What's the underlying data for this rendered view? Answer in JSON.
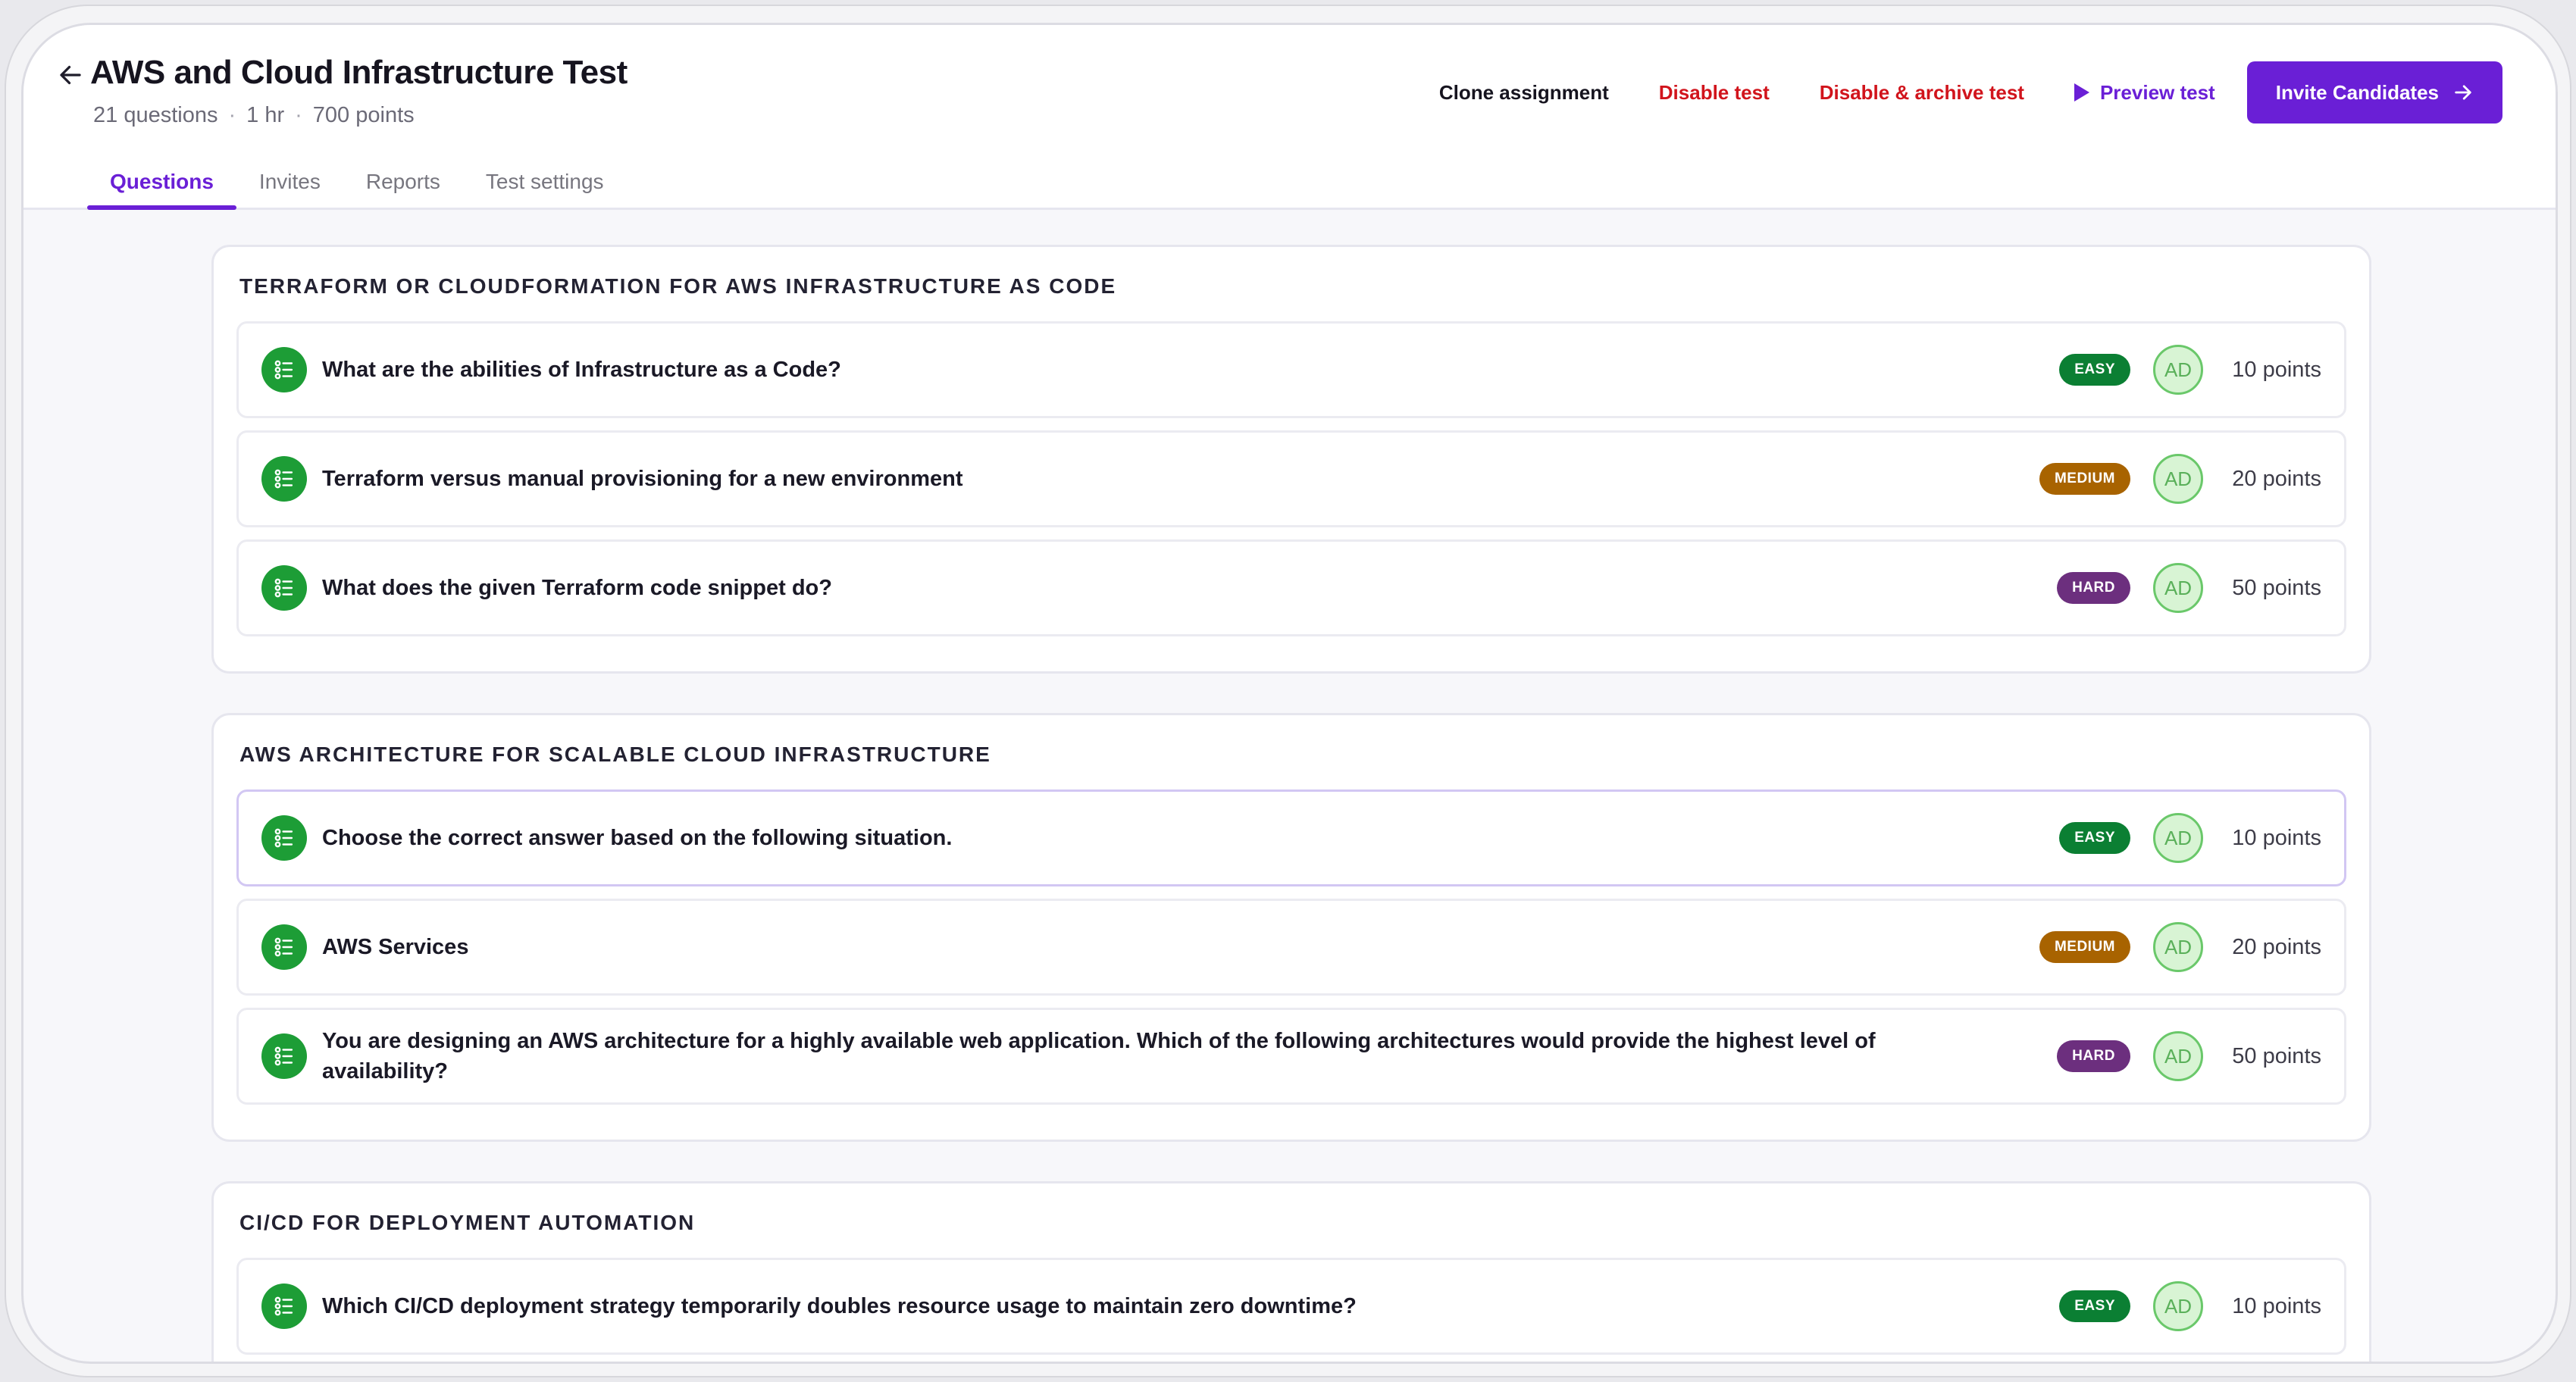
{
  "header": {
    "title": "AWS and Cloud Infrastructure Test",
    "meta": {
      "questions": "21 questions",
      "duration": "1 hr",
      "points": "700 points",
      "separator": "·"
    },
    "actions": {
      "clone": "Clone assignment",
      "disable": "Disable test",
      "disable_archive": "Disable & archive test",
      "preview": "Preview test",
      "invite": "Invite Candidates"
    },
    "tabs": [
      "Questions",
      "Invites",
      "Reports",
      "Test settings"
    ],
    "active_tab": "Questions"
  },
  "colors": {
    "accent": "#6a1fd6",
    "danger": "#d1141c",
    "easy": "#0b7f33",
    "medium": "#a86300",
    "hard": "#6c2f7e",
    "question_icon": "#1d9d36"
  },
  "sections": [
    {
      "title": "TERRAFORM OR CLOUDFORMATION FOR AWS INFRASTRUCTURE AS CODE",
      "questions": [
        {
          "text": "What are the abilities of Infrastructure as a Code?",
          "difficulty": "EASY",
          "author": "AD",
          "points": "10 points"
        },
        {
          "text": "Terraform versus manual provisioning for a new environment",
          "difficulty": "MEDIUM",
          "author": "AD",
          "points": "20 points"
        },
        {
          "text": "What does the given Terraform code snippet do?",
          "difficulty": "HARD",
          "author": "AD",
          "points": "50 points"
        }
      ]
    },
    {
      "title": "AWS ARCHITECTURE FOR SCALABLE CLOUD INFRASTRUCTURE",
      "questions": [
        {
          "text": "Choose the correct answer based on the following situation.",
          "difficulty": "EASY",
          "author": "AD",
          "points": "10 points"
        },
        {
          "text": "AWS Services",
          "difficulty": "MEDIUM",
          "author": "AD",
          "points": "20 points"
        },
        {
          "text": "You are designing an AWS architecture for a highly available web application. Which of the following architectures would provide the highest level of availability?",
          "difficulty": "HARD",
          "author": "AD",
          "points": "50 points"
        }
      ]
    },
    {
      "title": "CI/CD FOR DEPLOYMENT AUTOMATION",
      "questions": [
        {
          "text": "Which CI/CD deployment strategy temporarily doubles resource usage to maintain zero downtime?",
          "difficulty": "EASY",
          "author": "AD",
          "points": "10 points"
        }
      ]
    }
  ],
  "icons": {
    "back": "arrow-left-icon",
    "preview": "play-icon",
    "invite": "arrow-right-icon",
    "question": "checklist-icon"
  }
}
